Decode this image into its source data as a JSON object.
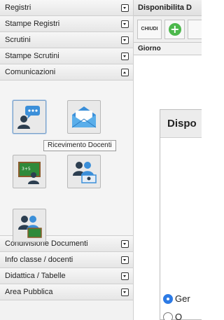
{
  "sidebar": {
    "sections_top": [
      {
        "label": "Registri",
        "state": "collapsed"
      },
      {
        "label": "Stampe Registri",
        "state": "collapsed"
      },
      {
        "label": "Scrutini",
        "state": "collapsed"
      },
      {
        "label": "Stampe Scrutini",
        "state": "collapsed"
      },
      {
        "label": "Comunicazioni",
        "state": "expanded"
      }
    ],
    "comunicazioni_tiles": [
      {
        "icon": "chat-user-icon",
        "active": true
      },
      {
        "icon": "envelope-icon"
      },
      {
        "icon": "teacher-blackboard-icon"
      },
      {
        "icon": "group-desk-icon"
      },
      {
        "icon": "group-chalkboard-icon"
      }
    ],
    "tooltip": "Ricevimento Docenti",
    "sections_bottom": [
      {
        "label": "Condivisione Documenti",
        "state": "collapsed"
      },
      {
        "label": "Info classe / docenti",
        "state": "collapsed"
      },
      {
        "label": "Didattica / Tabelle",
        "state": "collapsed"
      },
      {
        "label": "Area Pubblica",
        "state": "collapsed"
      }
    ]
  },
  "main": {
    "title": "Disponibilita D",
    "toolbar": {
      "close_label": "CHIUDI",
      "add_symbol": "+"
    },
    "grid_header": "Giorno",
    "dialog": {
      "title": "Dispo",
      "radio_options": [
        {
          "label": "Ger",
          "selected": true
        },
        {
          "label": "O",
          "selected": false
        }
      ]
    }
  },
  "colors": {
    "accent_green": "#4cb84c",
    "radio_blue": "#2d7be5"
  }
}
